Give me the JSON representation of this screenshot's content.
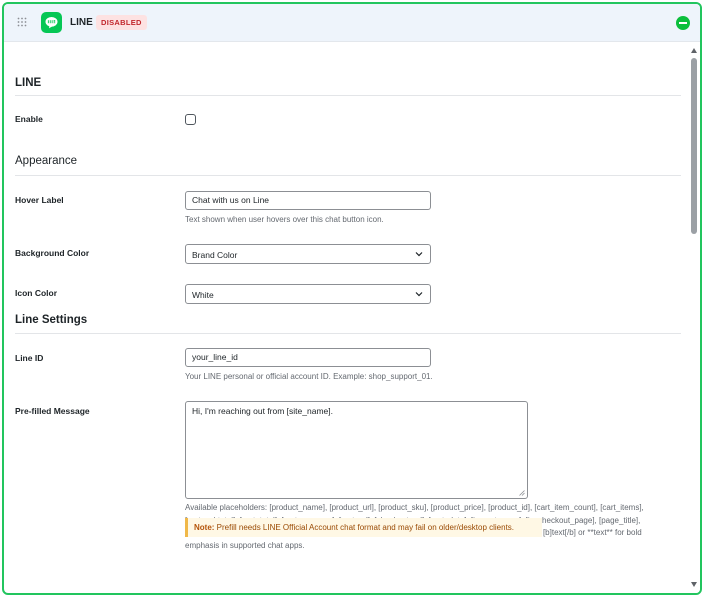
{
  "header": {
    "title": "LINE",
    "status_badge": "DISABLED",
    "icons": {
      "drag": "drag-handle-icon",
      "app": "line-app-icon",
      "toggle": "collapse-minus-icon"
    },
    "colors": {
      "accent": "#22c55e",
      "line_brand": "#06c755",
      "badge_bg": "#fde2e2",
      "badge_text": "#c1262b"
    }
  },
  "sections": {
    "line": {
      "title": "LINE"
    },
    "appearance": {
      "title": "Appearance"
    },
    "line_settings": {
      "title": "Line Settings"
    }
  },
  "fields": {
    "enable": {
      "label": "Enable",
      "checked": false
    },
    "hover_label": {
      "label": "Hover Label",
      "value": "Chat with us on Line",
      "help": "Text shown when user hovers over this chat button icon."
    },
    "background_color": {
      "label": "Background Color",
      "selected": "Brand Color"
    },
    "icon_color": {
      "label": "Icon Color",
      "selected": "White"
    },
    "line_id": {
      "label": "Line ID",
      "value": "your_line_id",
      "help": "Your LINE personal or official account ID. Example: shop_support_01."
    },
    "prefilled_message": {
      "label": "Pre-filled Message",
      "value": "Hi, I'm reaching out from [site_name].",
      "help_lines": [
        "Available placeholders: [product_name], [product_url], [product_sku], [product_price], [product_id], [cart_item_count], [cart_items],",
        "[cart_subtotal], [cart_total], [cart_currency], [cart_url], [checkout_url], [cart_data], [is_cart_page], [is_checkout_page], [page_title],",
        "[page_url], [site_name], [store_name], [current_date], [current_time]. Line breaks are preserved. Use [b]text[/b] or **text** for bold",
        "emphasis in supported chat apps."
      ],
      "note_label": "Note:",
      "note_text": " Prefill needs LINE Official Account chat format and may fail on older/desktop clients."
    }
  }
}
